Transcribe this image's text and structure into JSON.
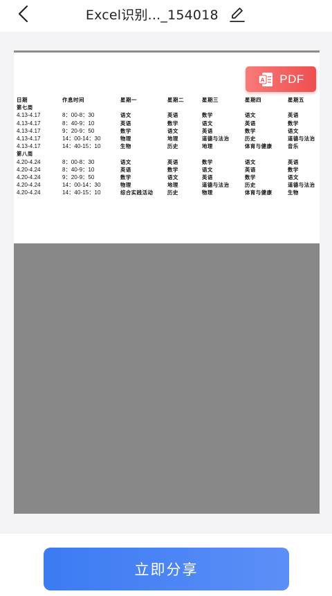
{
  "header": {
    "title": "Excel识别..._154018",
    "back_icon": "chevron-left-icon",
    "edit_icon": "pencil-icon"
  },
  "preview": {
    "pdf_button_label": "PDF",
    "pdf_icon": "pdf-file-icon",
    "table": {
      "columns": [
        "日期",
        "作息时间",
        "星期一",
        "星期二",
        "星期三",
        "星期四",
        "星期五"
      ],
      "rows": [
        [
          "第七周",
          "",
          "",
          "",
          "",
          "",
          ""
        ],
        [
          "4.13-4.17",
          "8：00-8：30",
          "语文",
          "英语",
          "数学",
          "语文",
          "英语"
        ],
        [
          "4.13-4.17",
          "8：40-9：10",
          "英语",
          "数学",
          "语文",
          "英语",
          "数学"
        ],
        [
          "4.13-4.17",
          "9：20-9：50",
          "数学",
          "语文",
          "英语",
          "数学",
          "语文"
        ],
        [
          "4.13-4.17",
          "14：00-14：30",
          "物理",
          "地理",
          "道德与法治",
          "历史",
          "道德与法治"
        ],
        [
          "4.13-4.17",
          "14：40-15：10",
          "生物",
          "历史",
          "地理",
          "体育与健康",
          "音乐"
        ],
        [
          "第八周",
          "",
          "",
          "",
          "",
          "",
          ""
        ],
        [
          "4.20-4.24",
          "8：00-8：30",
          "语文",
          "英语",
          "数学",
          "语文",
          "英语"
        ],
        [
          "4.20-4.24",
          "8：40-9：10",
          "英语",
          "数学",
          "语文",
          "英语",
          "数学"
        ],
        [
          "4.20-4.24",
          "9：20-9：50",
          "数学",
          "语文",
          "英语",
          "数学",
          "语文"
        ],
        [
          "4.20-4.24",
          "14：00-14：30",
          "物理",
          "地理",
          "道德与法治",
          "历史",
          "道德与法治"
        ],
        [
          "4.20-4.24",
          "14：40-15：10",
          "综合实践活动",
          "历史",
          "物理",
          "体育与健康",
          "生物"
        ]
      ]
    }
  },
  "footer": {
    "share_label": "立即分享"
  },
  "colors": {
    "pdf_button": "#ee5252",
    "share_button": "#4a84f5",
    "preview_background": "#888888"
  }
}
